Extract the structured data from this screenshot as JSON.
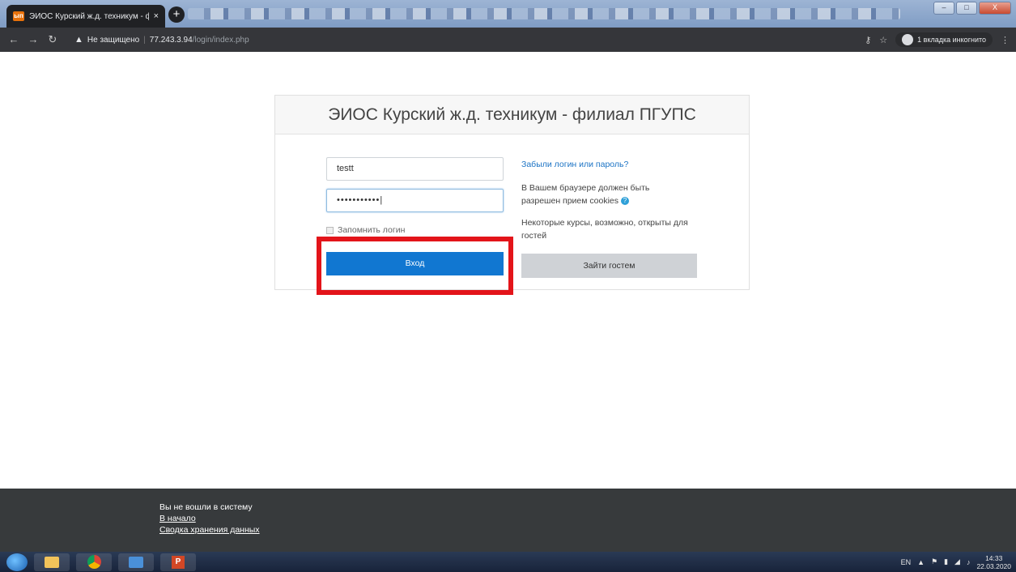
{
  "browser": {
    "tab_title": "ЭИОС Курский ж.д. техникум - ф",
    "tab_favicon": "ып",
    "security_text": "Не защищено",
    "url_host": "77.243.3.94",
    "url_path": "/login/index.php",
    "incognito_label": "1 вкладка инкогнито",
    "new_tab": "+",
    "close_tab": "×",
    "min": "–",
    "max": "□",
    "close": "X"
  },
  "login": {
    "site_title": "ЭИОС Курский ж.д. техникум - филиал ПГУПС",
    "username_value": "testt",
    "password_value": "•••••••••••|",
    "remember_label": "Запомнить логин",
    "login_button": "Вход",
    "forgot_link": "Забыли логин или пароль?",
    "cookies_text": "В Вашем браузере должен быть разрешен прием cookies",
    "guest_text": "Некоторые курсы, возможно, открыты для гостей",
    "guest_button": "Зайти гостем"
  },
  "footer": {
    "status": "Вы не вошли в систему",
    "home_link": "В начало",
    "data_link": "Сводка хранения данных"
  },
  "taskbar": {
    "lang": "EN",
    "time": "14:33",
    "date": "22.03.2020"
  },
  "colors": {
    "accent": "#1177d1",
    "highlight": "#e3141a"
  }
}
